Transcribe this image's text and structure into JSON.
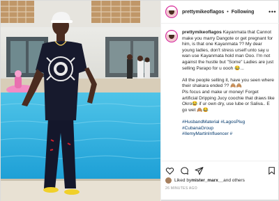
{
  "post": {
    "username": "prettymikeoflagos",
    "follow_separator": "•",
    "follow_label": "Following",
    "more_label": "•••"
  },
  "caption": {
    "username": "prettymikeoflagos",
    "paragraph1": "Kayanmata that Cannot make you marry Dangote or get pregnant for him, is that one Kayanmata ?? My dear young ladies, don't stress urself unto say u wan use Kayanmata hold man Ooo. I'm not against the hustle but \"Some\" Ladies are just selling Parapo for u oooh 😂...",
    "paragraph2": "All the people selling it, have you seen where their shakara ended ?? 🙈🙈\nPls focus and make ur money! Forget artificial Dripping Jucy coochie that draws like Okro😂 if ur own dry, use lube or Saliva.. E go wet 🙈😂",
    "hashtags": [
      "#HusbandMaterial #LagosPlug",
      "#CubanaGroup",
      "#IlemyMartinInfluencer #"
    ]
  },
  "likes": {
    "prefix": "Liked by ",
    "user": "mister_marx__",
    "suffix": " and others"
  },
  "timestamp": "26 MINUTES AGO",
  "icons": [
    "heart-icon",
    "comment-icon",
    "share-icon",
    "bookmark-icon",
    "more-icon"
  ]
}
